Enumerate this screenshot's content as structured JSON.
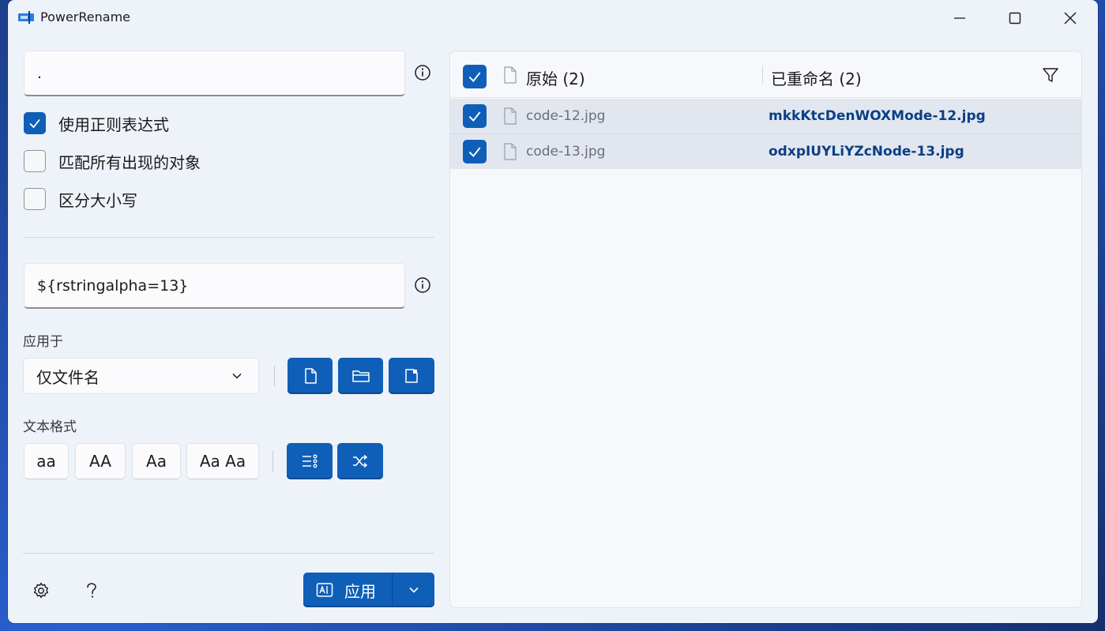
{
  "window": {
    "title": "PowerRename"
  },
  "search": {
    "value": "."
  },
  "options": [
    {
      "label": "使用正则表达式",
      "checked": true
    },
    {
      "label": "匹配所有出现的对象",
      "checked": false
    },
    {
      "label": "区分大小写",
      "checked": false
    }
  ],
  "replace": {
    "value": "${rstringalpha=13}"
  },
  "apply_to": {
    "label": "应用于",
    "selected": "仅文件名"
  },
  "text_format": {
    "label": "文本格式",
    "buttons": [
      "aa",
      "AA",
      "Aa",
      "Aa Aa"
    ]
  },
  "apply_button": {
    "label": "应用"
  },
  "list": {
    "header": {
      "original": "原始 (2)",
      "renamed": "已重命名 (2)"
    },
    "rows": [
      {
        "original": "code-12.jpg",
        "renamed": "mkkKtcDenWOXMode-12.jpg",
        "checked": true
      },
      {
        "original": "code-13.jpg",
        "renamed": "odxpIUYLiYZcNode-13.jpg",
        "checked": true
      }
    ]
  },
  "colors": {
    "accent": "#0f5fb8",
    "renamed_text": "#0b3f86"
  }
}
